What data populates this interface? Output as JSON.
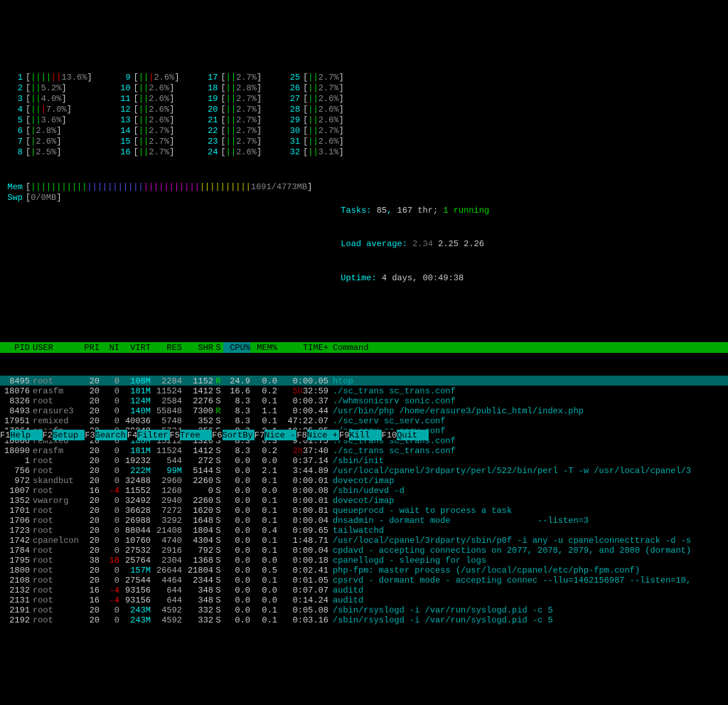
{
  "cpu_columns": [
    [
      {
        "n": "1",
        "bars": "||||||",
        "cls": "green",
        "pct": "13.6%",
        "w": 17
      },
      {
        "n": "2",
        "bars": "||",
        "cls": "green",
        "pct": "5.2%",
        "w": 17
      },
      {
        "n": "3",
        "bars": "||",
        "cls": "green",
        "pct": "4.0%",
        "w": 17
      },
      {
        "n": "4",
        "bars": "|||",
        "cls": "green",
        "pct": "7.0%",
        "w": 17
      },
      {
        "n": "5",
        "bars": "||",
        "cls": "green",
        "pct": "3.6%",
        "w": 17
      },
      {
        "n": "6",
        "bars": "|",
        "cls": "green",
        "pct": "2.8%",
        "w": 17
      },
      {
        "n": "7",
        "bars": "|",
        "cls": "green",
        "pct": "2.6%",
        "w": 17
      },
      {
        "n": "8",
        "bars": "|",
        "cls": "green",
        "pct": "2.5%",
        "w": 17
      }
    ],
    [
      {
        "n": "9",
        "bars": "|||",
        "cls": "green",
        "pct": "2.6%",
        "w": 17
      },
      {
        "n": "10",
        "bars": "||",
        "cls": "green",
        "pct": "2.6%",
        "w": 17
      },
      {
        "n": "11",
        "bars": "||",
        "cls": "green",
        "pct": "2.6%",
        "w": 17
      },
      {
        "n": "12",
        "bars": "||",
        "cls": "green",
        "pct": "2.6%",
        "w": 17
      },
      {
        "n": "13",
        "bars": "||",
        "cls": "green",
        "pct": "2.6%",
        "w": 17
      },
      {
        "n": "14",
        "bars": "||",
        "cls": "green",
        "pct": "2.7%",
        "w": 17
      },
      {
        "n": "15",
        "bars": "||",
        "cls": "green",
        "pct": "2.7%",
        "w": 17
      },
      {
        "n": "16",
        "bars": "||",
        "cls": "green",
        "pct": "2.7%",
        "w": 17
      }
    ],
    [
      {
        "n": "17",
        "bars": "||",
        "cls": "green",
        "pct": "2.7%",
        "w": 17
      },
      {
        "n": "18",
        "bars": "||",
        "cls": "green",
        "pct": "2.8%",
        "w": 17
      },
      {
        "n": "19",
        "bars": "||",
        "cls": "green",
        "pct": "2.7%",
        "w": 17
      },
      {
        "n": "20",
        "bars": "||",
        "cls": "green",
        "pct": "2.7%",
        "w": 17
      },
      {
        "n": "21",
        "bars": "||",
        "cls": "green",
        "pct": "2.7%",
        "w": 17
      },
      {
        "n": "22",
        "bars": "||",
        "cls": "green",
        "pct": "2.7%",
        "w": 17
      },
      {
        "n": "23",
        "bars": "||",
        "cls": "green",
        "pct": "2.7%",
        "w": 17
      },
      {
        "n": "24",
        "bars": "||",
        "cls": "green",
        "pct": "2.6%",
        "w": 17
      }
    ],
    [
      {
        "n": "25",
        "bars": "||",
        "cls": "green",
        "pct": "2.7%",
        "w": 17
      },
      {
        "n": "26",
        "bars": "||",
        "cls": "green",
        "pct": "2.7%",
        "w": 17
      },
      {
        "n": "27",
        "bars": "||",
        "cls": "green",
        "pct": "2.6%",
        "w": 17
      },
      {
        "n": "28",
        "bars": "||",
        "cls": "green",
        "pct": "2.6%",
        "w": 17
      },
      {
        "n": "29",
        "bars": "||",
        "cls": "green",
        "pct": "2.6%",
        "w": 17
      },
      {
        "n": "30",
        "bars": "||",
        "cls": "green",
        "pct": "2.7%",
        "w": 17
      },
      {
        "n": "31",
        "bars": "||",
        "cls": "green",
        "pct": "2.6%",
        "w": 17
      },
      {
        "n": "32",
        "bars": "||",
        "cls": "green",
        "pct": "3.1%",
        "w": 17
      }
    ]
  ],
  "mem": {
    "label": "Mem",
    "bars": "|||||||||||||||||||||||||||||||||||||||||||",
    "pct": "1691/4773MB",
    "w": 52
  },
  "swp": {
    "label": "Swp",
    "bars": "",
    "pct": "0/0MB",
    "w": 52
  },
  "sys": {
    "tasks_label": "Tasks:",
    "tasks": "85",
    "thr": "167 thr;",
    "running": "1 running",
    "load_label": "Load average:",
    "l1": "2.34",
    "l2": "2.25",
    "l3": "2.26",
    "uptime_label": "Uptime:",
    "uptime": "4 days, 00:49:38"
  },
  "headers": {
    "pid": "PID",
    "user": "USER",
    "pri": "PRI",
    "ni": "NI",
    "virt": "VIRT",
    "res": "RES",
    "shr": "SHR",
    "s": "S",
    "cpu": "CPU%",
    "mem": "MEM%",
    "time": "TIME+",
    "cmd": "Command"
  },
  "processes": [
    {
      "pid": "8495",
      "user": "root",
      "pri": "20",
      "ni": "0",
      "virt": "108M",
      "virtM": true,
      "res": "2284",
      "shr": "1152",
      "s": "R",
      "srun": true,
      "cpu": "24.9",
      "mem": "0.0",
      "time": "0:00.05",
      "cmd": "htop",
      "sel": true
    },
    {
      "pid": "18076",
      "user": "erasfm",
      "pri": "20",
      "ni": "0",
      "virt": "181M",
      "virtM": true,
      "res": "11524",
      "shr": "1412",
      "s": "S",
      "cpu": "16.6",
      "mem": "0.2",
      "time": "5h32:59",
      "timeRed": "5h",
      "cmd": "./sc_trans sc_trans.conf"
    },
    {
      "pid": "8326",
      "user": "root",
      "pri": "20",
      "ni": "0",
      "virt": "124M",
      "virtM": true,
      "res": "2584",
      "shr": "2276",
      "s": "S",
      "cpu": "8.3",
      "mem": "0.1",
      "time": "0:00.37",
      "cmd": "./whmsonicsrv sonic.conf"
    },
    {
      "pid": "8493",
      "user": "erasure3",
      "pri": "20",
      "ni": "0",
      "virt": "140M",
      "virtM": true,
      "res": "55848",
      "shr": "7300",
      "s": "R",
      "srun": true,
      "cpu": "8.3",
      "mem": "1.1",
      "time": "0:00.44",
      "cmd": "/usr/bin/php /home/erasure3/public_html/index.php"
    },
    {
      "pid": "17951",
      "user": "remixed",
      "pri": "20",
      "ni": "0",
      "virt": "40036",
      "res": "5748",
      "shr": "352",
      "s": "S",
      "cpu": "8.3",
      "mem": "0.1",
      "time": "47:22.07",
      "cmd": "./sc_serv sc_serv.conf"
    },
    {
      "pid": "17964",
      "user": "erasfm",
      "pri": "20",
      "ni": "0",
      "virt": "39848",
      "res": "5724",
      "shr": "356",
      "s": "S",
      "cpu": "8.3",
      "mem": "0.1",
      "time": "10:05.95",
      "cmd": "./sc_serv sc_serv.conf"
    },
    {
      "pid": "18066",
      "user": "remixed",
      "pri": "20",
      "ni": "0",
      "virt": "180M",
      "virtM": true,
      "res": "15212",
      "shr": "1320",
      "s": "S",
      "cpu": "8.3",
      "mem": "0.3",
      "time": "9:01.75",
      "cmd": "./sc_trans sc_trans.conf"
    },
    {
      "pid": "18090",
      "user": "erasfm",
      "pri": "20",
      "ni": "0",
      "virt": "181M",
      "virtM": true,
      "res": "11524",
      "shr": "1412",
      "s": "S",
      "cpu": "8.3",
      "mem": "0.2",
      "time": "2h37:40",
      "timeRed": "2h",
      "cmd": "./sc_trans sc_trans.conf"
    },
    {
      "pid": "1",
      "user": "root",
      "pri": "20",
      "ni": "0",
      "virt": "19232",
      "res": "544",
      "shr": "272",
      "s": "S",
      "cpu": "0.0",
      "mem": "0.0",
      "time": "0:37.14",
      "cmd": "/sbin/init"
    },
    {
      "pid": "756",
      "user": "root",
      "pri": "20",
      "ni": "0",
      "virt": "222M",
      "virtM": true,
      "res": "99M",
      "resM": true,
      "shr": "5144",
      "s": "S",
      "cpu": "0.0",
      "mem": "2.1",
      "time": "3:44.89",
      "cmd": "/usr/local/cpanel/3rdparty/perl/522/bin/perl -T -w /usr/local/cpanel/3"
    },
    {
      "pid": "972",
      "user": "skandbut",
      "pri": "20",
      "ni": "0",
      "virt": "32488",
      "res": "2960",
      "shr": "2260",
      "s": "S",
      "cpu": "0.0",
      "mem": "0.1",
      "time": "0:00.01",
      "cmd": "dovecot/imap"
    },
    {
      "pid": "1007",
      "user": "root",
      "pri": "16",
      "ni": "-4",
      "niNeg": true,
      "virt": "11552",
      "res": "1268",
      "shr": "0",
      "s": "S",
      "cpu": "0.0",
      "mem": "0.0",
      "time": "0:00.08",
      "cmd": "/sbin/udevd -d"
    },
    {
      "pid": "1352",
      "user": "vwarorg",
      "pri": "20",
      "ni": "0",
      "virt": "32492",
      "res": "2940",
      "shr": "2260",
      "s": "S",
      "cpu": "0.0",
      "mem": "0.1",
      "time": "0:00.01",
      "cmd": "dovecot/imap"
    },
    {
      "pid": "1701",
      "user": "root",
      "pri": "20",
      "ni": "0",
      "virt": "36628",
      "res": "7272",
      "shr": "1620",
      "s": "S",
      "cpu": "0.0",
      "mem": "0.1",
      "time": "0:00.81",
      "cmd": "queueprocd - wait to process a task"
    },
    {
      "pid": "1706",
      "user": "root",
      "pri": "20",
      "ni": "0",
      "virt": "26988",
      "res": "3292",
      "shr": "1648",
      "s": "S",
      "cpu": "0.0",
      "mem": "0.1",
      "time": "0:00.04",
      "cmd": "dnsadmin - dormant mode                 --listen=3"
    },
    {
      "pid": "1723",
      "user": "root",
      "pri": "20",
      "ni": "0",
      "virt": "88044",
      "res": "21408",
      "shr": "1804",
      "s": "S",
      "cpu": "0.0",
      "mem": "0.4",
      "time": "0:09.65",
      "cmd": "tailwatchd"
    },
    {
      "pid": "1742",
      "user": "cpanelcon",
      "pri": "20",
      "ni": "0",
      "virt": "10760",
      "res": "4740",
      "shr": "4304",
      "s": "S",
      "cpu": "0.0",
      "mem": "0.1",
      "time": "1:48.71",
      "cmd": "/usr/local/cpanel/3rdparty/sbin/p0f -i any -u cpanelconnecttrack -d -s"
    },
    {
      "pid": "1784",
      "user": "root",
      "pri": "20",
      "ni": "0",
      "virt": "27532",
      "res": "2916",
      "shr": "792",
      "s": "S",
      "cpu": "0.0",
      "mem": "0.1",
      "time": "0:00.04",
      "cmd": "cpdavd - accepting connections on 2077, 2078, 2079, and 2080 (dormant)"
    },
    {
      "pid": "1795",
      "user": "root",
      "pri": "38",
      "ni": "18",
      "niPos": true,
      "virt": "25764",
      "res": "2304",
      "shr": "1368",
      "s": "S",
      "cpu": "0.0",
      "mem": "0.0",
      "time": "0:00.18",
      "cmd": "cpanellogd - sleeping for logs"
    },
    {
      "pid": "1800",
      "user": "root",
      "pri": "20",
      "ni": "0",
      "virt": "157M",
      "virtM": true,
      "res": "26644",
      "shr": "21804",
      "s": "S",
      "cpu": "0.0",
      "mem": "0.5",
      "time": "0:02.41",
      "cmd": "php-fpm: master process (/usr/local/cpanel/etc/php-fpm.conf)"
    },
    {
      "pid": "2108",
      "user": "root",
      "pri": "20",
      "ni": "0",
      "virt": "27544",
      "res": "4464",
      "shr": "2344",
      "s": "S",
      "cpu": "0.0",
      "mem": "0.1",
      "time": "0:01.05",
      "cmd": "cpsrvd - dormant mode - accepting connec --llu=1462156987 --listen=10,"
    },
    {
      "pid": "2132",
      "user": "root",
      "pri": "16",
      "ni": "-4",
      "niNeg": true,
      "virt": "93156",
      "res": "644",
      "shr": "348",
      "s": "S",
      "cpu": "0.0",
      "mem": "0.0",
      "time": "0:07.07",
      "cmd": "auditd"
    },
    {
      "pid": "2131",
      "user": "root",
      "pri": "16",
      "ni": "-4",
      "niNeg": true,
      "virt": "93156",
      "res": "644",
      "shr": "348",
      "s": "S",
      "cpu": "0.0",
      "mem": "0.0",
      "time": "0:14.24",
      "cmd": "auditd"
    },
    {
      "pid": "2191",
      "user": "root",
      "pri": "20",
      "ni": "0",
      "virt": "243M",
      "virtM": true,
      "res": "4592",
      "shr": "332",
      "s": "S",
      "cpu": "0.0",
      "mem": "0.1",
      "time": "0:05.08",
      "cmd": "/sbin/rsyslogd -i /var/run/syslogd.pid -c 5"
    },
    {
      "pid": "2192",
      "user": "root",
      "pri": "20",
      "ni": "0",
      "virt": "243M",
      "virtM": true,
      "res": "4592",
      "shr": "332",
      "s": "S",
      "cpu": "0.0",
      "mem": "0.1",
      "time": "0:03.16",
      "cmd": "/sbin/rsyslogd -i /var/run/syslogd.pid -c 5"
    }
  ],
  "fkeys": [
    {
      "k": "F1",
      "l": "Help  "
    },
    {
      "k": "F2",
      "l": "Setup "
    },
    {
      "k": "F3",
      "l": "Search"
    },
    {
      "k": "F4",
      "l": "Filter"
    },
    {
      "k": "F5",
      "l": "Tree  "
    },
    {
      "k": "F6",
      "l": "SortBy"
    },
    {
      "k": "F7",
      "l": "Nice -"
    },
    {
      "k": "F8",
      "l": "Nice +"
    },
    {
      "k": "F9",
      "l": "Kill  "
    },
    {
      "k": "F10",
      "l": "Quit  "
    }
  ]
}
